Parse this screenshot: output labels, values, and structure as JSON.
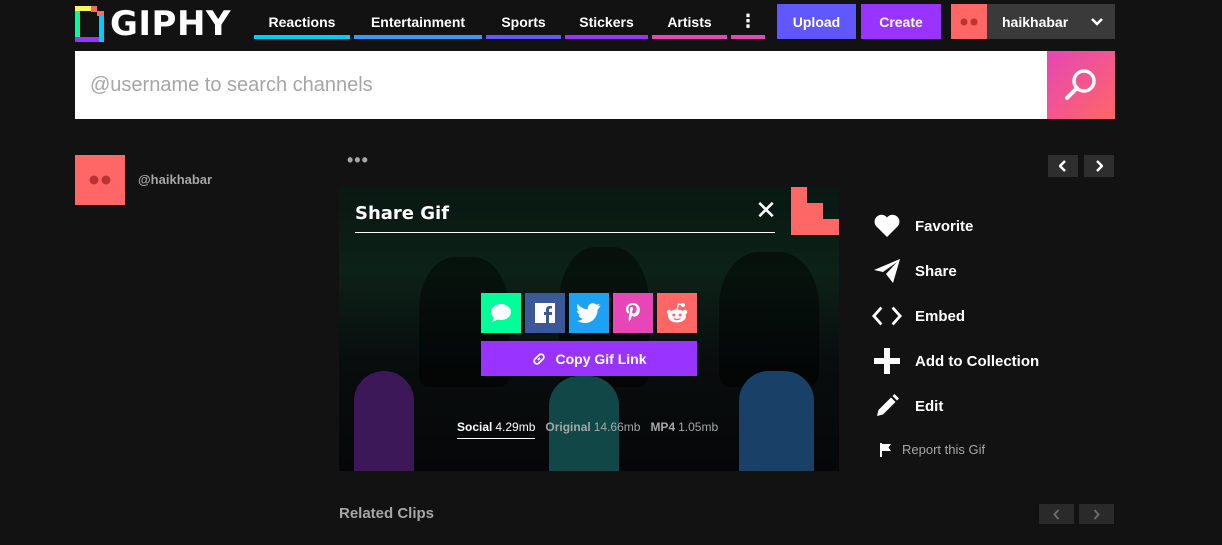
{
  "header": {
    "logo_text": "GIPHY",
    "nav": [
      {
        "label": "Reactions",
        "color": "#00ccff"
      },
      {
        "label": "Entertainment",
        "color": "#3399ff"
      },
      {
        "label": "Sports",
        "color": "#6157ff"
      },
      {
        "label": "Stickers",
        "color": "#9933ff"
      },
      {
        "label": "Artists",
        "color": "#e646b6"
      }
    ],
    "more_label": "⋮",
    "upload_label": "Upload",
    "create_label": "Create",
    "username": "haikhabar"
  },
  "search": {
    "placeholder": "@username to search channels"
  },
  "channel": {
    "handle": "@haikhabar"
  },
  "gif_menu": {
    "dots": "•••"
  },
  "share": {
    "title": "Share Gif",
    "close": "✕",
    "copy_label": "Copy Gif Link",
    "sizes": [
      {
        "name": "Social",
        "size": "4.29mb",
        "active": true
      },
      {
        "name": "Original",
        "size": "14.66mb",
        "active": false
      },
      {
        "name": "MP4",
        "size": "1.05mb",
        "active": false
      }
    ]
  },
  "actions": [
    {
      "label": "Favorite",
      "icon": "heart-icon"
    },
    {
      "label": "Share",
      "icon": "paper-plane-icon"
    },
    {
      "label": "Embed",
      "icon": "code-icon"
    },
    {
      "label": "Add to Collection",
      "icon": "plus-icon"
    },
    {
      "label": "Edit",
      "icon": "pencil-icon"
    }
  ],
  "report_label": "Report this Gif",
  "related_title": "Related Clips",
  "colors": {
    "upload": "#6157ff",
    "create": "#9933ff",
    "avatar": "#ff6666",
    "sms": "#00ff99",
    "facebook": "#3b5998",
    "twitter": "#1da1f2",
    "pinterest": "#e646b6",
    "reddit": "#ff6666"
  }
}
